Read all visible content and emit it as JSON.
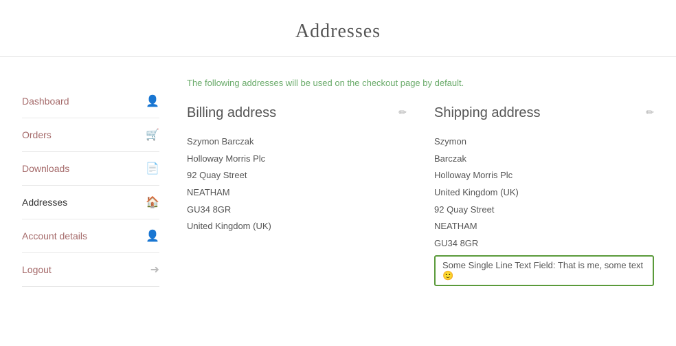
{
  "page": {
    "title": "Addresses"
  },
  "sidebar": {
    "items": [
      {
        "label": "Dashboard",
        "icon": "👤",
        "active": false
      },
      {
        "label": "Orders",
        "icon": "🛒",
        "active": false
      },
      {
        "label": "Downloads",
        "icon": "📄",
        "active": false
      },
      {
        "label": "Addresses",
        "icon": "🏠",
        "active": true
      },
      {
        "label": "Account details",
        "icon": "👤",
        "active": false
      },
      {
        "label": "Logout",
        "icon": "➜",
        "active": false
      }
    ]
  },
  "content": {
    "info_text": "The following addresses will be used on the checkout page by default.",
    "billing": {
      "title": "Billing address",
      "lines": [
        "Szymon Barczak",
        "Holloway Morris Plc",
        "92 Quay Street",
        "NEATHAM",
        "GU34 8GR",
        "United Kingdom (UK)"
      ]
    },
    "shipping": {
      "title": "Shipping address",
      "lines": [
        "Szymon",
        "Barczak",
        "Holloway Morris Plc",
        "United Kingdom (UK)",
        "92 Quay Street",
        "NEATHAM",
        "GU34 8GR"
      ],
      "custom_field": "Some Single Line Text Field: That is me, some text 🙂"
    }
  }
}
